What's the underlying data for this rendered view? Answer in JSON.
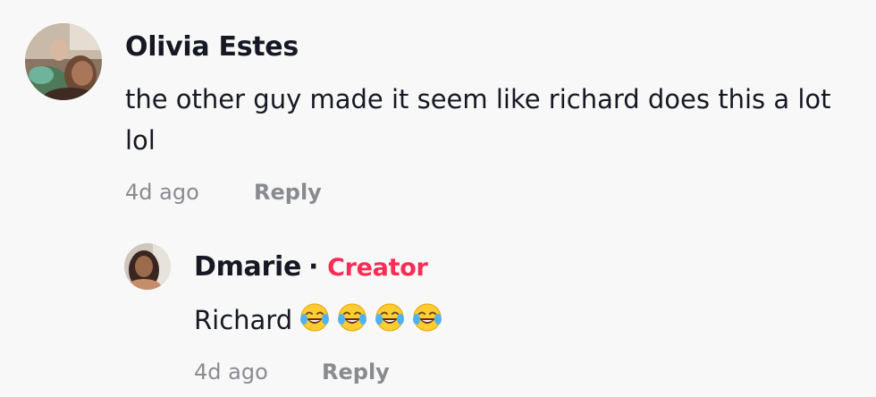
{
  "comments": [
    {
      "author": "Olivia Estes",
      "text": "the other guy made it seem like richard does this a lot lol",
      "time": "4d ago",
      "reply_label": "Reply"
    }
  ],
  "reply": {
    "author": "Dmarie",
    "separator": "·",
    "badge": "Creator",
    "text": "Richard",
    "emoji_icon": "face-with-tears-of-joy",
    "emoji_count": 4,
    "time": "4d ago",
    "reply_label": "Reply"
  },
  "colors": {
    "background": "#f8f8f8",
    "text": "#161823",
    "muted": "#8a8b91",
    "creator_badge": "#fe2c55"
  }
}
